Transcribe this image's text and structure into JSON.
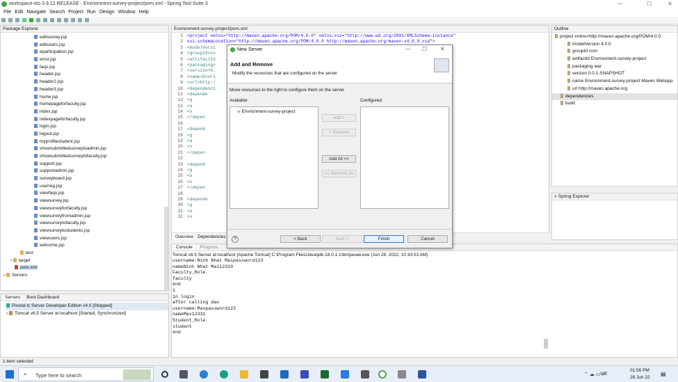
{
  "window": {
    "title": "workspace-sts-3.9.12.RELEASE - Envrionment-survey-project/pom.xml - Spring Tool Suite 3",
    "minimize": "—",
    "maximize": "☐",
    "close": "✕"
  },
  "menu": [
    "File",
    "Edit",
    "Navigate",
    "Search",
    "Project",
    "Run",
    "Design",
    "Window",
    "Help"
  ],
  "package_explorer": {
    "title": "Package Explorer",
    "files": [
      "editsurvey.jsp",
      "editusers.jsp",
      "eparticipation.jsp",
      "error.jsp",
      "faqs.jsp",
      "header.jsp",
      "header2.jsp",
      "header3.jsp",
      "home.jsp",
      "homepageforfaculty.jsp",
      "index.jsp",
      "indexpageforfaculty.jsp",
      "login.jsp",
      "logout.jsp",
      "myprofilestudent.jsp",
      "showsubmittedsurveytoadmin.jsp",
      "showsubmittedsurveytofaculty.jsp",
      "support.jsp",
      "supportadmin.jsp",
      "surveyboard.jsp",
      "userreg.jsp",
      "viewfaqs.jsp",
      "viewsurvey.jsp",
      "viewsurveyforfaculty.jsp",
      "viewsurveyfromadmin.jsp",
      "viewsurveytofaculty.jsp",
      "viewsurveytostudents.jsp",
      "viewusers.jsp",
      "welcome.jsp"
    ],
    "other": [
      "test",
      "target",
      "pom.xml",
      "Servers"
    ]
  },
  "servers_view": {
    "tabs": [
      "Servers",
      "Boot Dashboard"
    ],
    "items": [
      "Pivotal tc Server Developer Edition v4.0  [Stopped]",
      "Tomcat v8.5 Server at localhost  [Started, Synchronized]"
    ]
  },
  "editor": {
    "tab": "Envrionment-survey-project/pom.xml",
    "line_numbers": [
      "1",
      "2",
      "3",
      "4",
      "5",
      "6",
      "7",
      "8",
      "9",
      "10",
      "11",
      "12",
      "13",
      "14",
      "15",
      "16",
      "17",
      "18",
      "19",
      "20",
      "21",
      "22",
      "23",
      "24",
      "25",
      "26",
      "27",
      "28",
      "29",
      "30",
      "31",
      "32"
    ],
    "lines": [
      "<project xmlns=\"http://maven.apache.org/POM/4.0.0\" xmlns:xsi=\"http://www.w3.org/2001/XMLSchema-instance\"",
      "  xsi:schemaLocation=\"http://maven.apache.org/POM/4.0.0 http://maven.apache.org/maven-v4_0_0.xsd\">",
      "  <modelVersi",
      "  <groupId>co",
      "  <artifactId",
      "  <packaging>",
      "  <version>0.",
      "  <name>Envri",
      "  <url>http:/",
      "  <dependenci",
      "    <depende",
      "      <g",
      "      <a",
      "      <v",
      "    </depen",
      "",
      "    <depend",
      "      <g",
      "      <a",
      "      <v",
      "    </depen",
      "",
      "    <depend",
      "      <g",
      "      <a",
      "      <v",
      "    </depen",
      "",
      "    <depende",
      "      <g",
      "      <a",
      "      <v"
    ],
    "bottom_tabs": [
      "Overview",
      "Dependencies"
    ]
  },
  "outline": {
    "title": "Outline",
    "items": [
      "project xmlns=http://maven.apache.org/POM/4.0.0",
      "modelVersion  4.0.0",
      "groupId  com",
      "artifactId  Envrionment-survey-project",
      "packaging  war",
      "version  0.0.1-SNAPSHOT",
      "name  Envrionment-survey-project Maven Webapp",
      "url  http://maven.apache.org",
      "dependencies",
      "build"
    ]
  },
  "spring_explorer": {
    "title": "Spring Explorer"
  },
  "console": {
    "tabs": [
      "Console",
      "Progress"
    ],
    "header": "Tomcat v8.5 Server at localhost [Apache Tomcat] C:\\Program Files\\Java\\jdk-18.0.1.1\\bin\\javaw.exe  (Jun 28, 2022, 10:33:03 AM)",
    "lines": [
      "username:Ninh Nhat Maipassword123",
      "nameNinh Nhat Mai12320",
      "Faculty_Role",
      "faculty",
      "end",
      "1",
      "in login",
      "after calling dao",
      "username:Maxpassword123",
      "nameMax12331",
      "Student_Role",
      "student",
      "end"
    ]
  },
  "status": {
    "text": "1 item selected"
  },
  "dialog": {
    "window_title": "New Server",
    "heading": "Add and Remove",
    "subtitle": "Modify the resources that are configured on the server",
    "instruction": "Move resources to the right to configure them on the server",
    "available_label": "Available:",
    "configured_label": "Configured:",
    "available_items": [
      "Envrionment-survey-project"
    ],
    "buttons": {
      "add": "Add >",
      "remove": "< Remove",
      "add_all": "Add All >>",
      "remove_all": "<< Remove All",
      "back": "< Back",
      "next": "Next >",
      "finish": "Finish",
      "cancel": "Cancel"
    },
    "help": "?"
  },
  "taskbar": {
    "search_placeholder": "Type here to search",
    "time": "01:56 PM",
    "date": "28 Jun 22",
    "lang": "VIE"
  },
  "colors": {
    "accent": "#3a74c7",
    "taskbar": "#e7eef8"
  }
}
